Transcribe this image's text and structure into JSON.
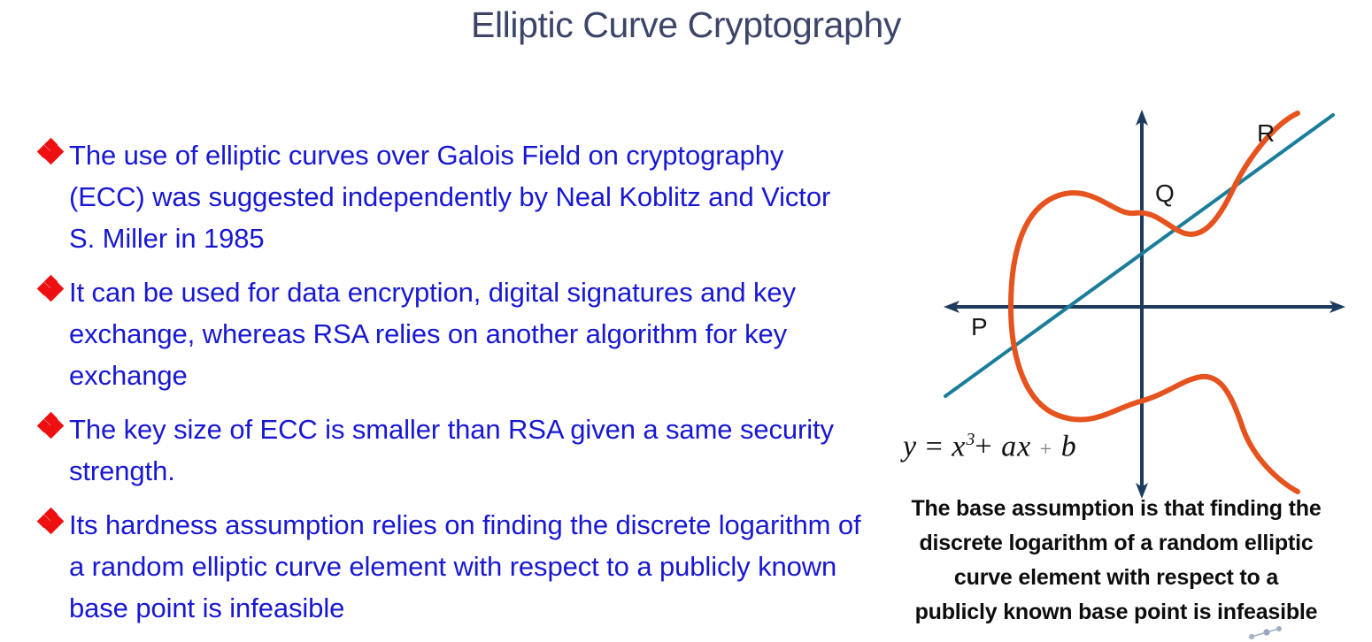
{
  "slide": {
    "title": "Elliptic Curve Cryptography",
    "background_color": "#ffffff",
    "title_color": "#3c4568",
    "body_text_color": "#1818d4",
    "bullet_marker_color": "#ee1010"
  },
  "bullets": [
    {
      "marker": "four-diamond-bullet",
      "text": "The use of elliptic curves over Galois Field on cryptography (ECC) was suggested independently by Neal Koblitz and Victor S. Miller in 1985"
    },
    {
      "marker": "four-diamond-bullet",
      "text": "It can be used for data encryption, digital signatures and key exchange, whereas RSA relies on another algorithm for key exchange"
    },
    {
      "marker": "four-diamond-bullet",
      "text": "The key size of ECC is smaller than RSA given a same security strength."
    },
    {
      "marker": "four-diamond-bullet",
      "text": "Its hardness assumption relies on finding the discrete logarithm of a random elliptic curve element with respect to a publicly known base point is infeasible"
    }
  ],
  "figure": {
    "name": "elliptic-curve-point-addition-diagram",
    "curve_color": "#e5531f",
    "axis_color": "#1d3b5c",
    "secant_line_color": "#1a7d99",
    "point_labels": [
      {
        "id": "P",
        "label": "P"
      },
      {
        "id": "Q",
        "label": "Q"
      },
      {
        "id": "R",
        "label": "R"
      }
    ],
    "equation": {
      "lhs": "y",
      "equals": "=",
      "term_x": "x",
      "exponent": "3",
      "plus_one": "+",
      "term_ax": "ax",
      "plus_two": "+",
      "term_b": "b",
      "full": "y = x3 + ax + b"
    }
  },
  "caption": {
    "lines": [
      "The base assumption is that finding the",
      "discrete logarithm of a random elliptic",
      "curve element with respect to a",
      "publicly known base point is infeasible"
    ]
  }
}
